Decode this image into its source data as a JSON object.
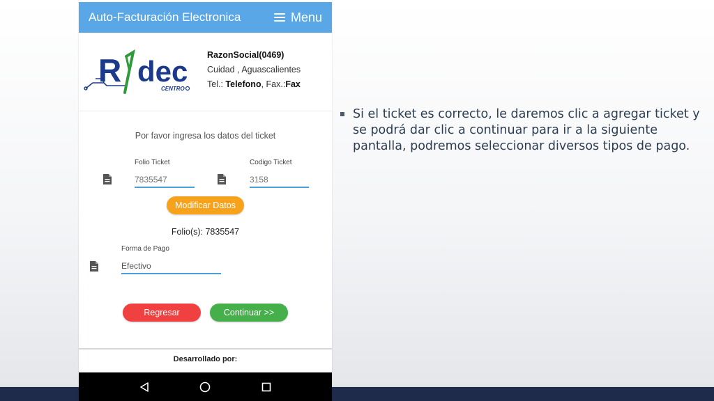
{
  "app": {
    "title": "Auto-Facturación Electronica",
    "menu_label": "Menu"
  },
  "company": {
    "logo_text": "Ridec",
    "logo_sub": "CENTRO",
    "name": "RazonSocial(0469)",
    "city": "Cuidad , Aguascalientes",
    "tel_label": "Tel.:",
    "tel_value": "Telefono",
    "fax_label": ", Fax.:",
    "fax_value": "Fax"
  },
  "form": {
    "prompt": "Por favor ingresa los datos del ticket",
    "folio": {
      "label": "Folio Ticket",
      "placeholder": "7835547"
    },
    "codigo": {
      "label": "Codigo Ticket",
      "placeholder": "3158"
    },
    "modify_button": "Modificar Datos",
    "folios_text": "Folio(s): 7835547",
    "pago": {
      "label": "Forma de Pago",
      "value": "Efectivo"
    },
    "back_button": "Regresar",
    "continue_button": "Continuar >>"
  },
  "footer": {
    "developed_by": "Desarrollado por:"
  },
  "slide": {
    "bullet": "Si el ticket es correcto, le daremos clic a agregar ticket y se podrá dar clic a continuar para ir a la siguiente pantalla, podremos seleccionar diversos tipos de pago."
  },
  "colors": {
    "appbar": "#5aa7e8",
    "orange_button": "#f7a21b",
    "red_button": "#f04040",
    "green_button": "#45b04a",
    "input_underline": "#4a9fd9",
    "logo_blue": "#1b3a8c",
    "logo_green": "#2e9a3a"
  },
  "icons": {
    "menu": "hamburger-icon",
    "field": "document-icon",
    "nav_back": "triangle-back-icon",
    "nav_home": "circle-home-icon",
    "nav_recents": "square-recents-icon"
  }
}
